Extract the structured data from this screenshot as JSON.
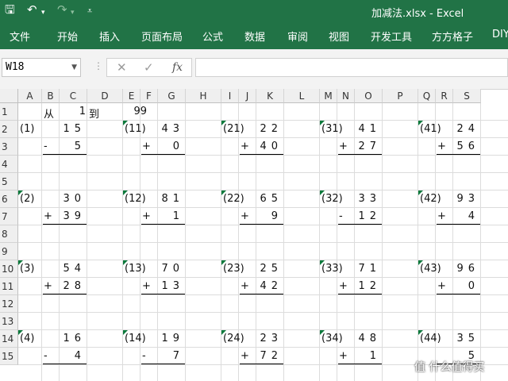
{
  "window": {
    "title": "加减法.xlsx - Excel"
  },
  "ribbon": {
    "tabs": [
      "文件",
      "开始",
      "插入",
      "页面布局",
      "公式",
      "数据",
      "审阅",
      "视图",
      "开发工具",
      "方方格子",
      "DIY"
    ],
    "icons": [
      "save-icon",
      "undo-icon",
      "redo-icon",
      "customize-icon"
    ]
  },
  "formula_bar": {
    "name_box": "W18",
    "formula": "",
    "fx_label": "fx"
  },
  "columns": [
    "A",
    "B",
    "C",
    "D",
    "E",
    "F",
    "G",
    "H",
    "I",
    "J",
    "K",
    "L",
    "M",
    "N",
    "O",
    "P",
    "Q",
    "R",
    "S"
  ],
  "rows": [
    "1",
    "2",
    "3",
    "4",
    "5",
    "6",
    "7",
    "8",
    "9",
    "10",
    "11",
    "12",
    "13",
    "14",
    "15"
  ],
  "header_row": {
    "from_label": "从",
    "from_value": "1",
    "to_label": "到",
    "to_value": "99"
  },
  "problems": [
    [
      {
        "label": "(1)",
        "top": "15",
        "op": "-",
        "bottom": "5"
      },
      {
        "label": "(11)",
        "top": "43",
        "op": "+",
        "bottom": "0"
      },
      {
        "label": "(21)",
        "top": "22",
        "op": "+",
        "bottom": "40"
      },
      {
        "label": "(31)",
        "top": "41",
        "op": "+",
        "bottom": "27"
      },
      {
        "label": "(41)",
        "top": "24",
        "op": "+",
        "bottom": "56"
      }
    ],
    [
      {
        "label": "(2)",
        "top": "30",
        "op": "+",
        "bottom": "39"
      },
      {
        "label": "(12)",
        "top": "81",
        "op": "+",
        "bottom": "1"
      },
      {
        "label": "(22)",
        "top": "65",
        "op": "+",
        "bottom": "9"
      },
      {
        "label": "(32)",
        "top": "33",
        "op": "-",
        "bottom": "12"
      },
      {
        "label": "(42)",
        "top": "93",
        "op": "+",
        "bottom": "4"
      }
    ],
    [
      {
        "label": "(3)",
        "top": "54",
        "op": "+",
        "bottom": "28"
      },
      {
        "label": "(13)",
        "top": "70",
        "op": "+",
        "bottom": "13"
      },
      {
        "label": "(23)",
        "top": "25",
        "op": "+",
        "bottom": "42"
      },
      {
        "label": "(33)",
        "top": "71",
        "op": "+",
        "bottom": "12"
      },
      {
        "label": "(43)",
        "top": "96",
        "op": "+",
        "bottom": "0"
      }
    ],
    [
      {
        "label": "(4)",
        "top": "16",
        "op": "-",
        "bottom": "4"
      },
      {
        "label": "(14)",
        "top": "19",
        "op": "-",
        "bottom": "7"
      },
      {
        "label": "(24)",
        "top": "23",
        "op": "+",
        "bottom": "72"
      },
      {
        "label": "(34)",
        "top": "48",
        "op": "+",
        "bottom": "1"
      },
      {
        "label": "(44)",
        "top": "35",
        "op": "",
        "bottom": "5"
      }
    ]
  ],
  "watermark": "值 什么值得买"
}
